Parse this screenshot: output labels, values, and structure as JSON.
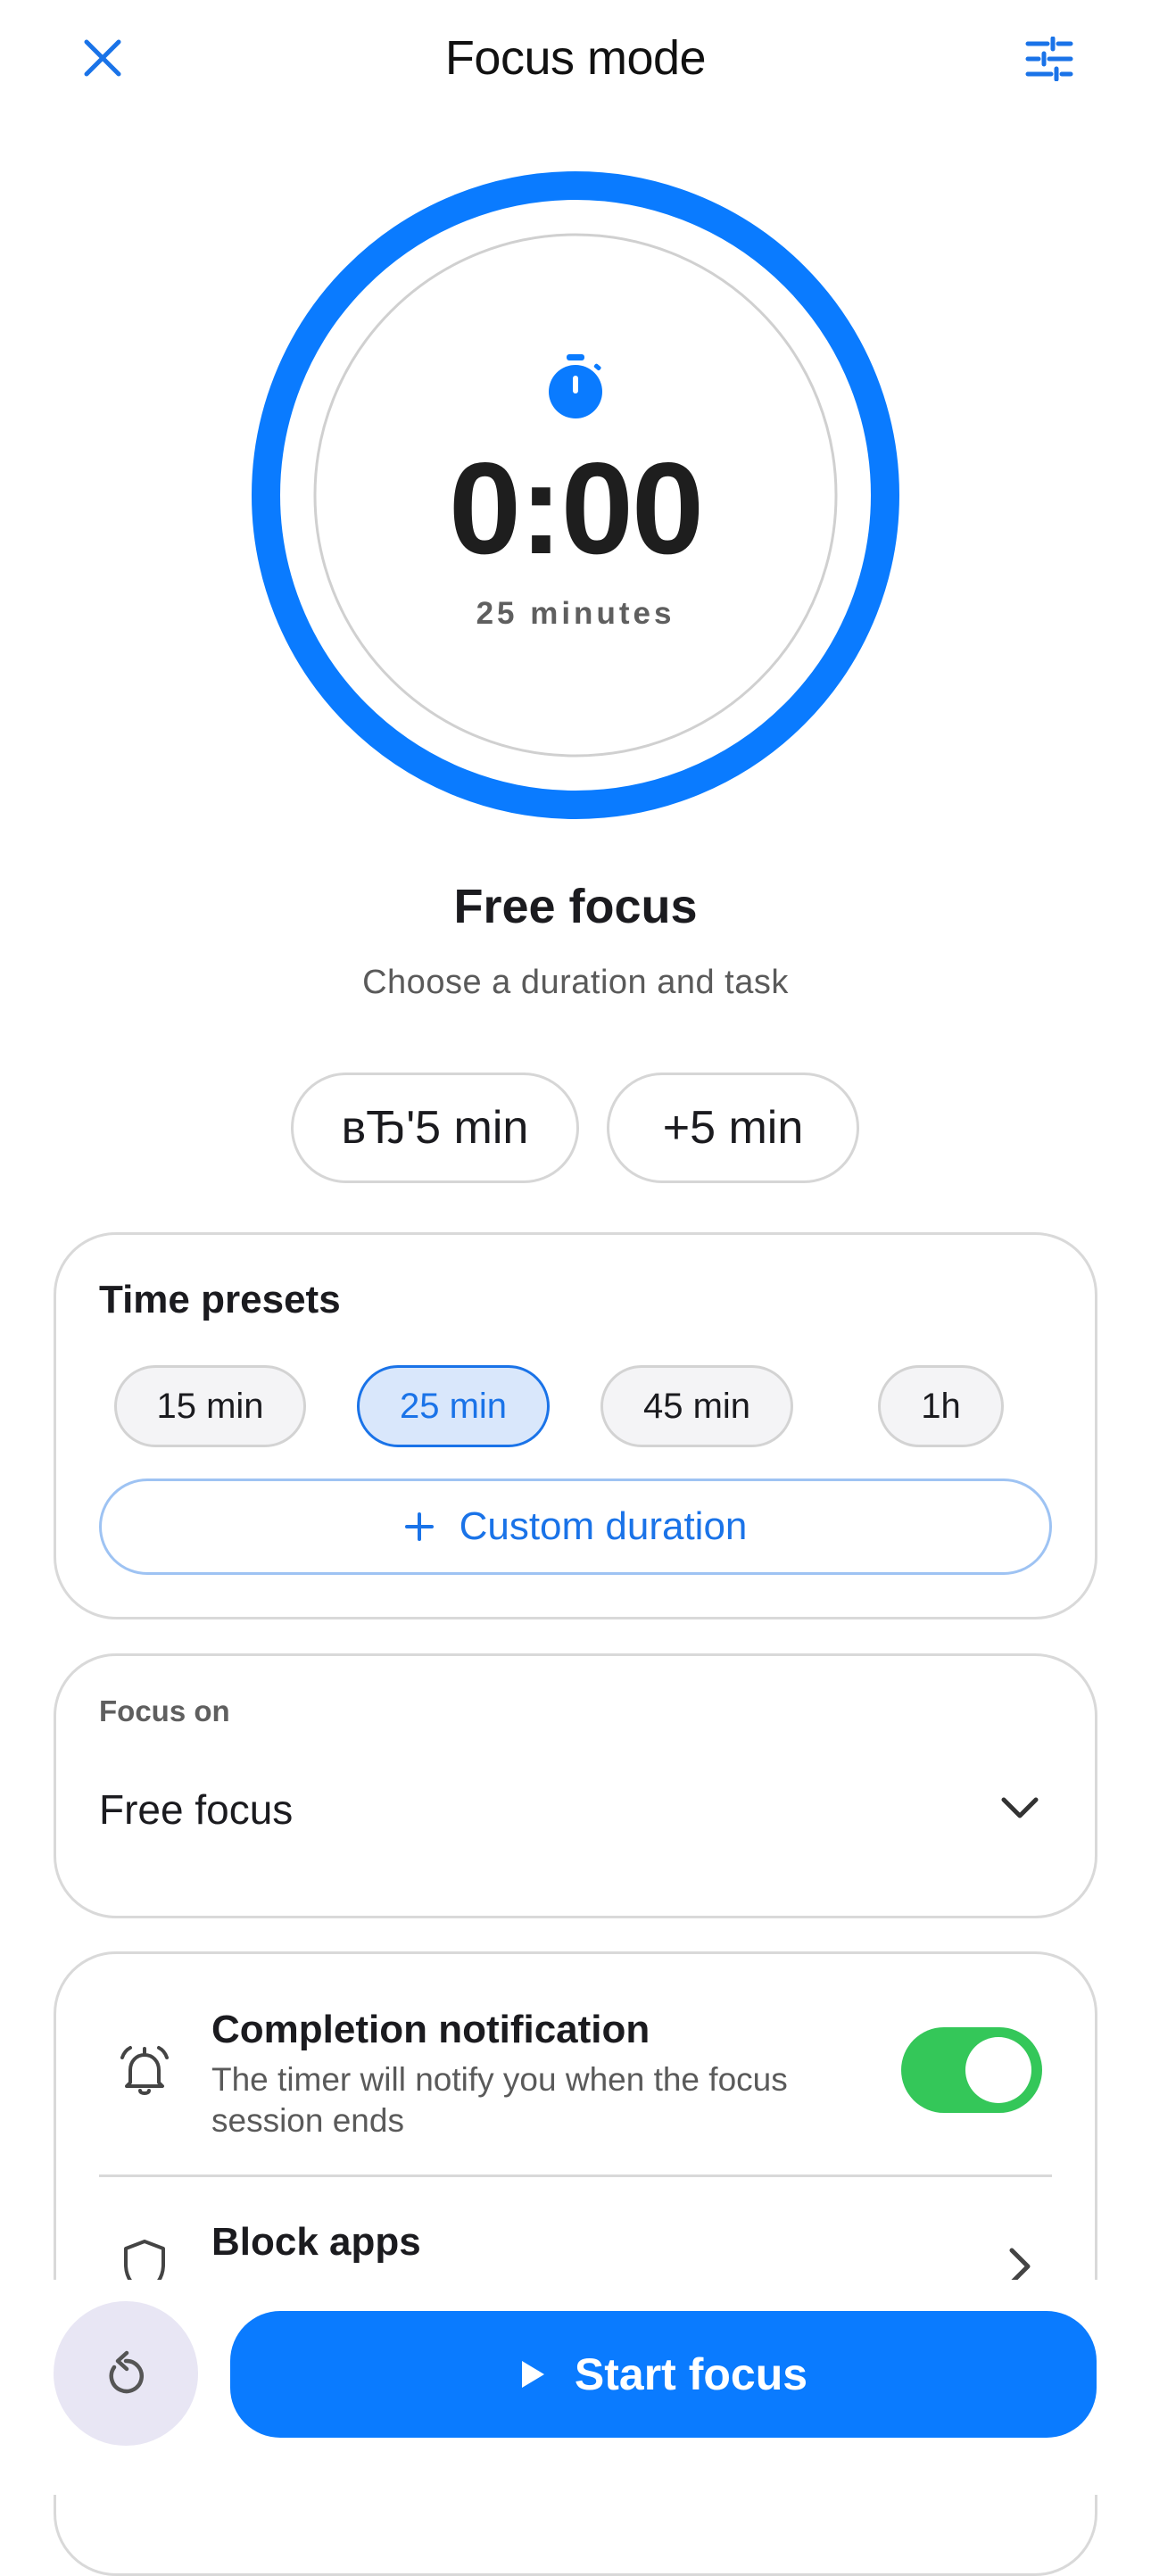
{
  "header": {
    "title": "Focus mode",
    "close_icon": "close-icon",
    "settings_icon": "sliders-icon",
    "accent": "#1a73e8"
  },
  "timer": {
    "icon": "stopwatch-icon",
    "time": "0:00",
    "subtitle": "25 minutes",
    "ring_color": "#0a7bff",
    "progress": 1.0
  },
  "mode": {
    "title": "Free focus",
    "subtitle": "Choose a duration and task"
  },
  "adjust": {
    "minus_label": "вЂ'5 min",
    "plus_label": "+5 min"
  },
  "presets": {
    "title": "Time presets",
    "options": [
      "15 min",
      "25 min",
      "45 min",
      "1h"
    ],
    "selected": "25 min",
    "custom_label": "Custom duration"
  },
  "focus_on": {
    "label": "Focus on",
    "value": "Free focus"
  },
  "settings": {
    "notification": {
      "title": "Completion notification",
      "description": "The timer will notify you when the focus session ends",
      "enabled": true,
      "toggle_color": "#34c759"
    },
    "block_apps": {
      "title": "Block apps"
    }
  },
  "actions": {
    "reset_icon": "reset-icon",
    "start_label": "Start focus",
    "start_color": "#0a7bff"
  }
}
